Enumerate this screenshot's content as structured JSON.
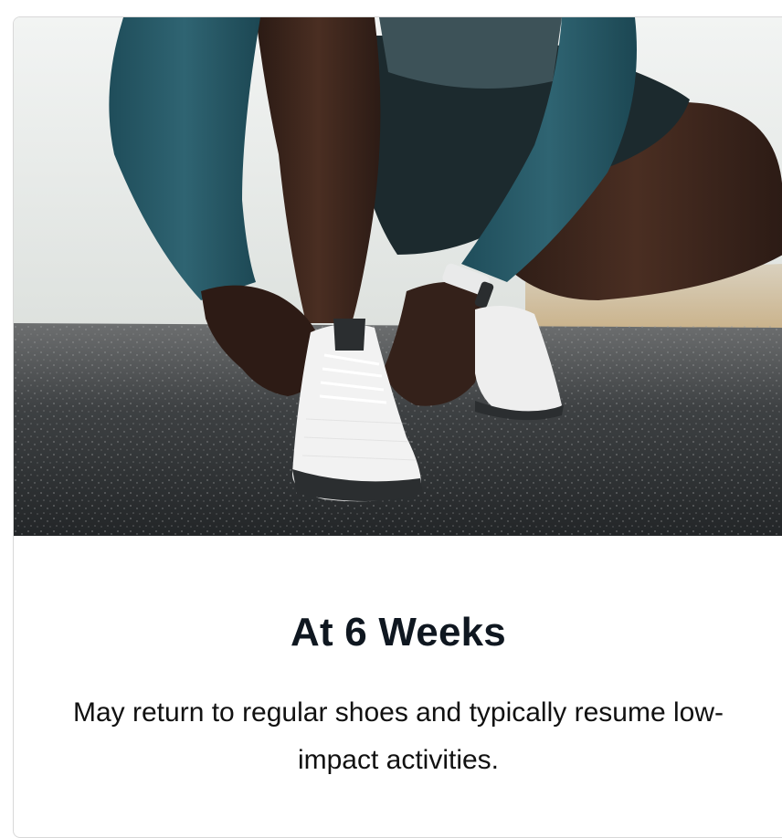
{
  "card": {
    "title": "At 6 Weeks",
    "description": "May return to regular shoes and typically resume low-impact activities."
  }
}
